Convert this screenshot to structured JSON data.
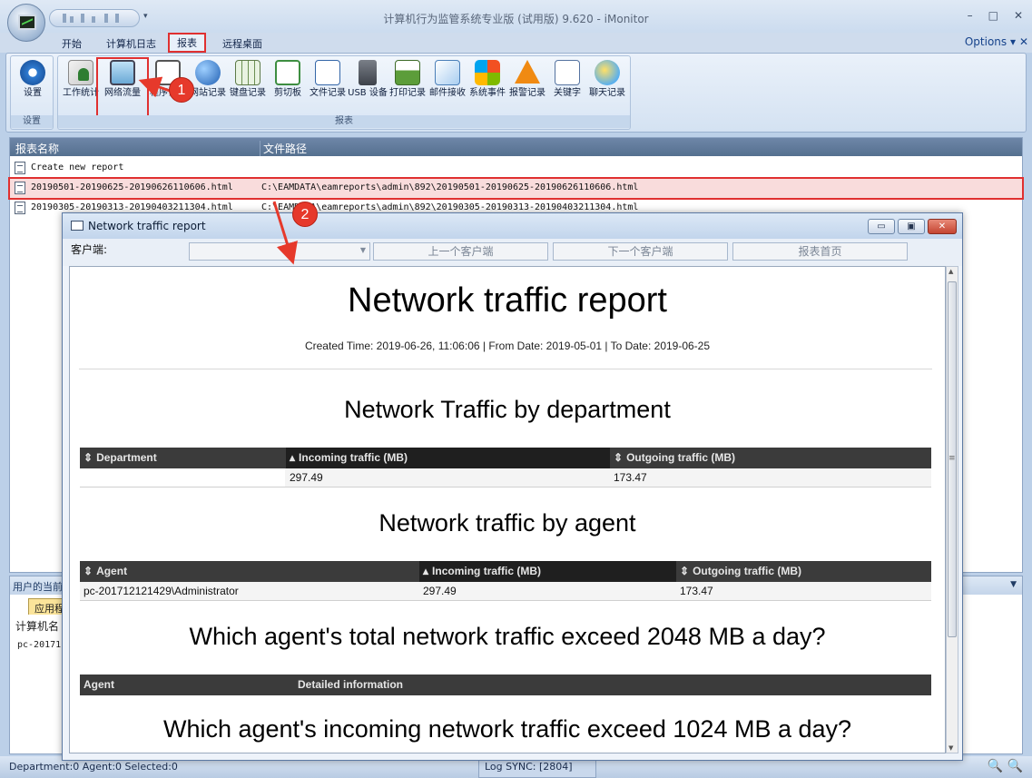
{
  "window": {
    "title": "计算机行为监管系统专业版 (试用版) 9.620 - iMonitor",
    "min": "–",
    "max": "□",
    "close": "✕"
  },
  "ribbon_tabs": [
    "开始",
    "计算机日志",
    "报表",
    "远程桌面"
  ],
  "options_label": "Options",
  "ribbon": {
    "settings_group": {
      "label": "设置",
      "button": "设置"
    },
    "reports_group": {
      "label": "报表",
      "buttons": [
        "工作统计",
        "网络流量",
        "程序记录",
        "网站记录",
        "键盘记录",
        "剪切板",
        "文件记录",
        "USB 设备",
        "打印记录",
        "邮件接收",
        "系统事件",
        "报警记录",
        "关键字",
        "聊天记录"
      ]
    }
  },
  "report_list": {
    "col_name": "报表名称",
    "col_path": "文件路径",
    "rows": [
      {
        "name": "Create new report",
        "path": ""
      },
      {
        "name": "20190501-20190625-20190626110606.html",
        "path": "C:\\EAMDATA\\eamreports\\admin\\892\\20190501-20190625-20190626110606.html"
      },
      {
        "name": "20190305-20190313-20190403211304.html",
        "path": "C:\\EAMDATA\\eamreports\\admin\\892\\20190305-20190313-20190403211304.html"
      }
    ]
  },
  "lower_panel": {
    "title": "用户的当前",
    "tab": "应用程",
    "col": "计算机名",
    "value": "pc-20171"
  },
  "status": {
    "left": "Department:0   Agent:0   Selected:0",
    "log": "Log SYNC: [2804]"
  },
  "child": {
    "title": "Network traffic report",
    "client_label": "客户端:",
    "combo_value": "",
    "prev_client": "上一个客户端",
    "next_client": "下一个客户端",
    "report_home": "报表首页"
  },
  "report": {
    "title": "Network traffic report",
    "meta": "Created Time: 2019-06-26, 11:06:06 | From Date: 2019-05-01 | To Date: 2019-06-25",
    "section1": {
      "heading": "Network Traffic by department",
      "headers": [
        "Department",
        "Incoming traffic (MB)",
        "Outgoing traffic (MB)"
      ],
      "row": [
        "",
        "297.49",
        "173.47"
      ]
    },
    "section2": {
      "heading": "Network traffic by agent",
      "headers": [
        "Agent",
        "Incoming traffic (MB)",
        "Outgoing traffic (MB)"
      ],
      "row": [
        "pc-201712121429\\Administrator",
        "297.49",
        "173.47"
      ]
    },
    "section3": {
      "heading": "Which agent's total network traffic exceed 2048 MB a day?",
      "headers": [
        "Agent",
        "Detailed information"
      ]
    },
    "section4": {
      "heading": "Which agent's incoming network traffic exceed 1024 MB a day?"
    }
  },
  "annotations": [
    "1",
    "2"
  ],
  "colors": {
    "annotation": "#e6392b",
    "table_header": "#3b3b3b",
    "list_header": "#5a7494"
  }
}
